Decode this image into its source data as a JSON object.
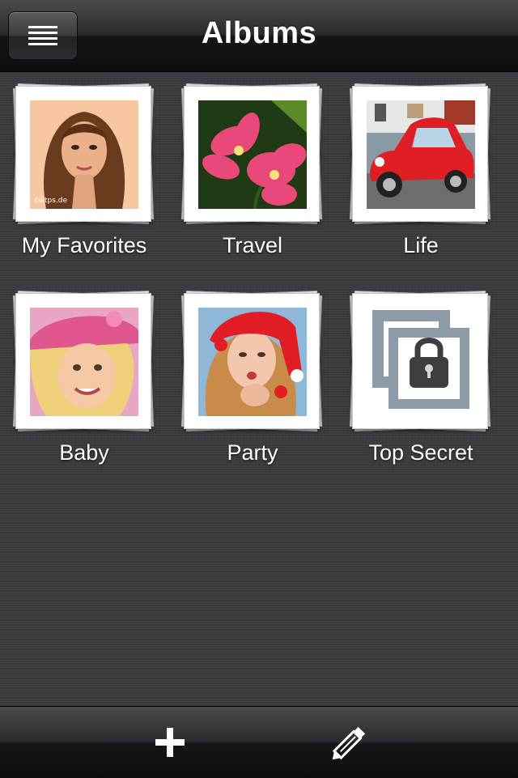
{
  "nav": {
    "title": "Albums"
  },
  "albums": [
    {
      "label": "My Favorites",
      "photo_watermark": "Glitps.de"
    },
    {
      "label": "Travel"
    },
    {
      "label": "Life"
    },
    {
      "label": "Baby"
    },
    {
      "label": "Party"
    },
    {
      "label": "Top Secret"
    }
  ],
  "icons": {
    "menu": "menu-icon",
    "add": "plus-icon",
    "edit": "pencil-icon",
    "locked": "lock-icon"
  },
  "colors": {
    "bar_top": "#4a4b4e",
    "bar_bottom": "#0e0e0f",
    "background": "#3a3b3f",
    "text": "#ffffff"
  }
}
